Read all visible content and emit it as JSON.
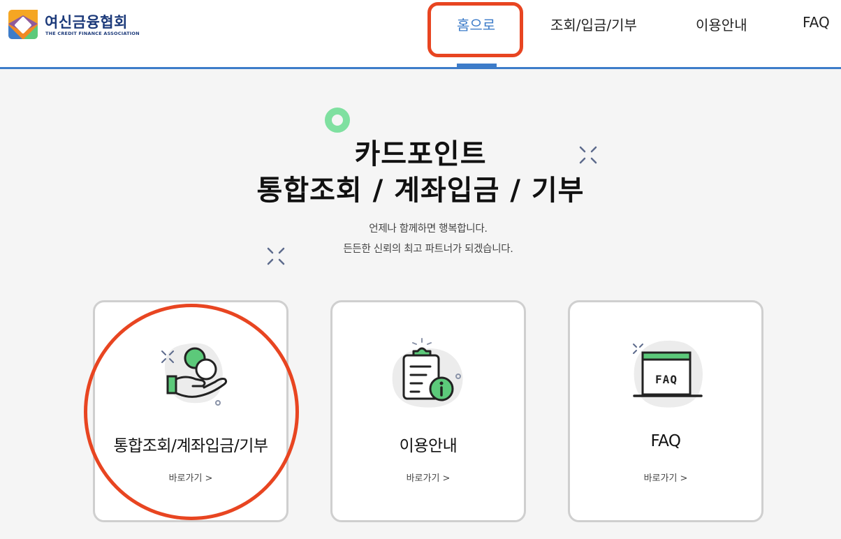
{
  "header": {
    "logo": {
      "name_kr": "여신금융협회",
      "name_en": "THE CREDIT FINANCE ASSOCIATION"
    },
    "nav": [
      {
        "label": "홈으로",
        "active": true
      },
      {
        "label": "조회/입금/기부",
        "active": false
      },
      {
        "label": "이용안내",
        "active": false
      },
      {
        "label": "FAQ",
        "active": false
      }
    ]
  },
  "hero": {
    "title_line1": "카드포인트",
    "title_line2": "통합조회 / 계좌입금 / 기부",
    "subtitle_line1": "언제나 함께하면 행복합니다.",
    "subtitle_line2": "든든한 신뢰의 최고 파트너가 되겠습니다."
  },
  "cards": [
    {
      "title": "통합조회/계좌입금/기부",
      "link": "바로가기 >",
      "icon": "hand-coins-icon"
    },
    {
      "title": "이용안내",
      "link": "바로가기 >",
      "icon": "clipboard-info-icon"
    },
    {
      "title": "FAQ",
      "link": "바로가기 >",
      "icon": "faq-window-icon",
      "icon_text": "FAQ"
    }
  ],
  "colors": {
    "accent_blue": "#3d7cc9",
    "highlight_red": "#e84521",
    "icon_green": "#5cc97a",
    "logo_navy": "#1c3a7a"
  }
}
